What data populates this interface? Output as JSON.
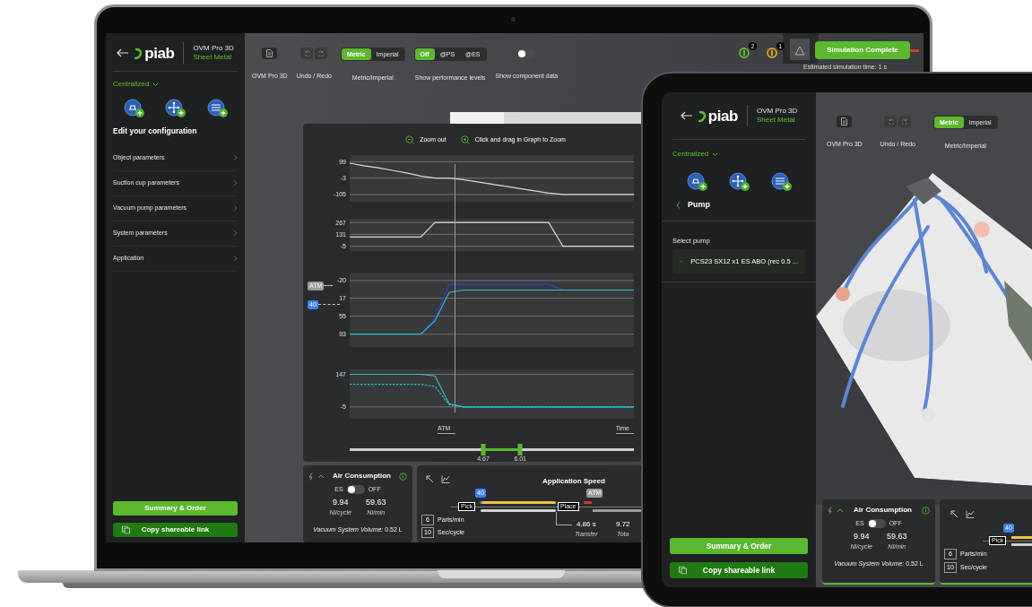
{
  "laptop": {
    "sidebar": {
      "logo": "piab",
      "product": "OVM Pro 3D",
      "variant": "Sheet Metal",
      "mode": "Centralized",
      "heading": "Edit your configuration",
      "menu": [
        "Object parameters",
        "Suction cup parameters",
        "Vacuum pump parameters",
        "System parameters",
        "Application"
      ],
      "actions": [
        {
          "label": "Summary & Order",
          "kind": "primary"
        },
        {
          "label": "Copy shareable link",
          "kind": "copy"
        }
      ]
    },
    "toolbar": {
      "units": [
        {
          "label": "Metric",
          "selected": true
        },
        {
          "label": "Imperial",
          "selected": false
        }
      ],
      "performance": [
        {
          "label": "Off",
          "selected": true
        },
        {
          "label": "@PS",
          "selected": false
        },
        {
          "label": "@ES",
          "selected": false
        }
      ],
      "component_data": {
        "on": false
      },
      "captions": [
        "OVM Pro 3D",
        "Undo / Redo",
        "Metric/Imperial",
        "Show performance levels",
        "Show component data"
      ]
    },
    "status": {
      "notifications": [
        {
          "count": "2",
          "color": "#5cb82e"
        },
        {
          "count": "1",
          "color": "#e0a21c"
        }
      ],
      "button": "Simulation Complete",
      "estimate": "Estimated simulation time: 1 s"
    },
    "graph": {
      "zoom_out": "Zoom out",
      "zoom_hint": "Click and drag in Graph to Zoom",
      "cursor_label": "ATM",
      "markers": [
        {
          "label": "ATM",
          "color": "#9a9a9a"
        },
        {
          "label": "40",
          "color": "#3b82f6"
        }
      ],
      "charts": [
        {
          "chart_data": {
            "type": "line",
            "grid": true,
            "ylim": [
              -150,
              140
            ],
            "yticks": [
              99,
              -3,
              -105
            ],
            "series": [
              {
                "color": "#d9d9d9",
                "values": [
                  90,
                  74,
                  61,
                  45,
                  29,
                  10,
                  -3,
                  -3,
                  -12,
                  -26,
                  -40,
                  -54,
                  -68,
                  -82,
                  -96,
                  -105,
                  -105,
                  -105,
                  -105,
                  -105,
                  -105
                ]
              }
            ]
          }
        },
        {
          "chart_data": {
            "type": "line",
            "grid": true,
            "ylim": [
              -60,
              310
            ],
            "yticks": [
              267,
              131,
              -5
            ],
            "series": [
              {
                "color": "#d9d9d9",
                "values": [
                  100,
                  100,
                  100,
                  100,
                  100,
                  100,
                  267,
                  267,
                  267,
                  267,
                  267,
                  267,
                  267,
                  267,
                  267,
                  -5,
                  -5,
                  -5,
                  -5,
                  -5,
                  -5
                ]
              }
            ]
          }
        },
        {
          "chart_data": {
            "type": "line",
            "grid": true,
            "ylim": [
              120,
              -35
            ],
            "yticks": [
              -20,
              17,
              55,
              93
            ],
            "series": [
              {
                "color": "#2b3fd6",
                "values": [
                  null,
                  null,
                  null,
                  null,
                  null,
                  93,
                  60,
                  -12,
                  -12,
                  -12,
                  -12,
                  -12,
                  -12,
                  -12,
                  -12,
                  0,
                  0,
                  null,
                  null,
                  null,
                  null
                ]
              },
              {
                "color": "#28c0c8",
                "values": [
                  93,
                  93,
                  93,
                  93,
                  93,
                  93,
                  65,
                  5,
                  0,
                  0,
                  0,
                  0,
                  0,
                  0,
                  0,
                  0,
                  0,
                  0,
                  0,
                  0,
                  0
                ]
              }
            ]
          }
        },
        {
          "chart_data": {
            "type": "line",
            "grid": true,
            "ylim": [
              -60,
              170
            ],
            "yticks": [
              147,
              -5
            ],
            "xlabel": "Time",
            "series": [
              {
                "color": "#28c0c8",
                "values": [
                  147,
                  147,
                  147,
                  147,
                  147,
                  147,
                  140,
                  10,
                  -5,
                  -5,
                  -5,
                  -5,
                  -5,
                  -5,
                  -5,
                  -5,
                  -5,
                  -5,
                  -5,
                  -5,
                  -5
                ]
              },
              {
                "color": "#28c0c8",
                "line_style": "dashed",
                "values": [
                  100,
                  100,
                  100,
                  100,
                  100,
                  100,
                  90,
                  5,
                  -5,
                  -5,
                  -5,
                  -5,
                  -5,
                  -5,
                  -5,
                  -5,
                  -5,
                  -5,
                  -5,
                  -5,
                  -5
                ]
              }
            ]
          }
        }
      ],
      "range": [
        {
          "label": "4.67",
          "level": 0.47
        },
        {
          "label": "6.01",
          "level": 0.6
        }
      ]
    },
    "air": {
      "title": "Air Consumption",
      "es_label": "ES",
      "es_on": false,
      "off_label": "OFF",
      "values": [
        {
          "value": "9.94",
          "unit": "Nl/cycle"
        },
        {
          "value": "59.63",
          "unit": "Nl/min"
        }
      ],
      "volume": "*Vacuum System Volume:* 0.52 L"
    },
    "speed": {
      "title": "Application Speed",
      "level_badge": "40",
      "atm_badge": "ATM",
      "pick": "Pick",
      "place": "Place",
      "inputs": [
        {
          "value": "6",
          "label": "Parts/min"
        },
        {
          "value": "10",
          "label": "Sec/cycle"
        }
      ],
      "times": [
        {
          "value": "4.86 s",
          "label": "Transfer"
        },
        {
          "value": "9.72",
          "label": "Tota"
        }
      ]
    }
  },
  "tablet": {
    "sidebar": {
      "logo": "piab",
      "product": "OVM Pro 3D",
      "variant": "Sheet Metal",
      "mode": "Centralized",
      "back": "Pump",
      "select_label": "Select pump",
      "select_value": "PCS23 SX12 x1 ES ABO (rec 0.5 ...",
      "actions": [
        {
          "label": "Summary & Order",
          "kind": "primary"
        },
        {
          "label": "Copy shareable link",
          "kind": "copy"
        }
      ]
    },
    "toolbar": {
      "units": [
        {
          "label": "Metric",
          "selected": true
        },
        {
          "label": "Imperial",
          "selected": false
        }
      ],
      "captions": [
        "OVM Pro 3D",
        "Undo / Redo",
        "Metric/Imperial"
      ]
    },
    "air": {
      "title": "Air Consumption",
      "es_label": "ES",
      "es_on": false,
      "off_label": "OFF",
      "values": [
        {
          "value": "9.94",
          "unit": "Nl/cycle"
        },
        {
          "value": "59.63",
          "unit": "Nl/min"
        }
      ],
      "volume": "*Vacuum System Volume:* 0.52 L"
    },
    "speed": {
      "level_badge": "40",
      "pick": "Pick",
      "inputs": [
        {
          "value": "6",
          "label": "Parts/min"
        },
        {
          "value": "10",
          "label": "Sec/cycle"
        }
      ]
    }
  }
}
